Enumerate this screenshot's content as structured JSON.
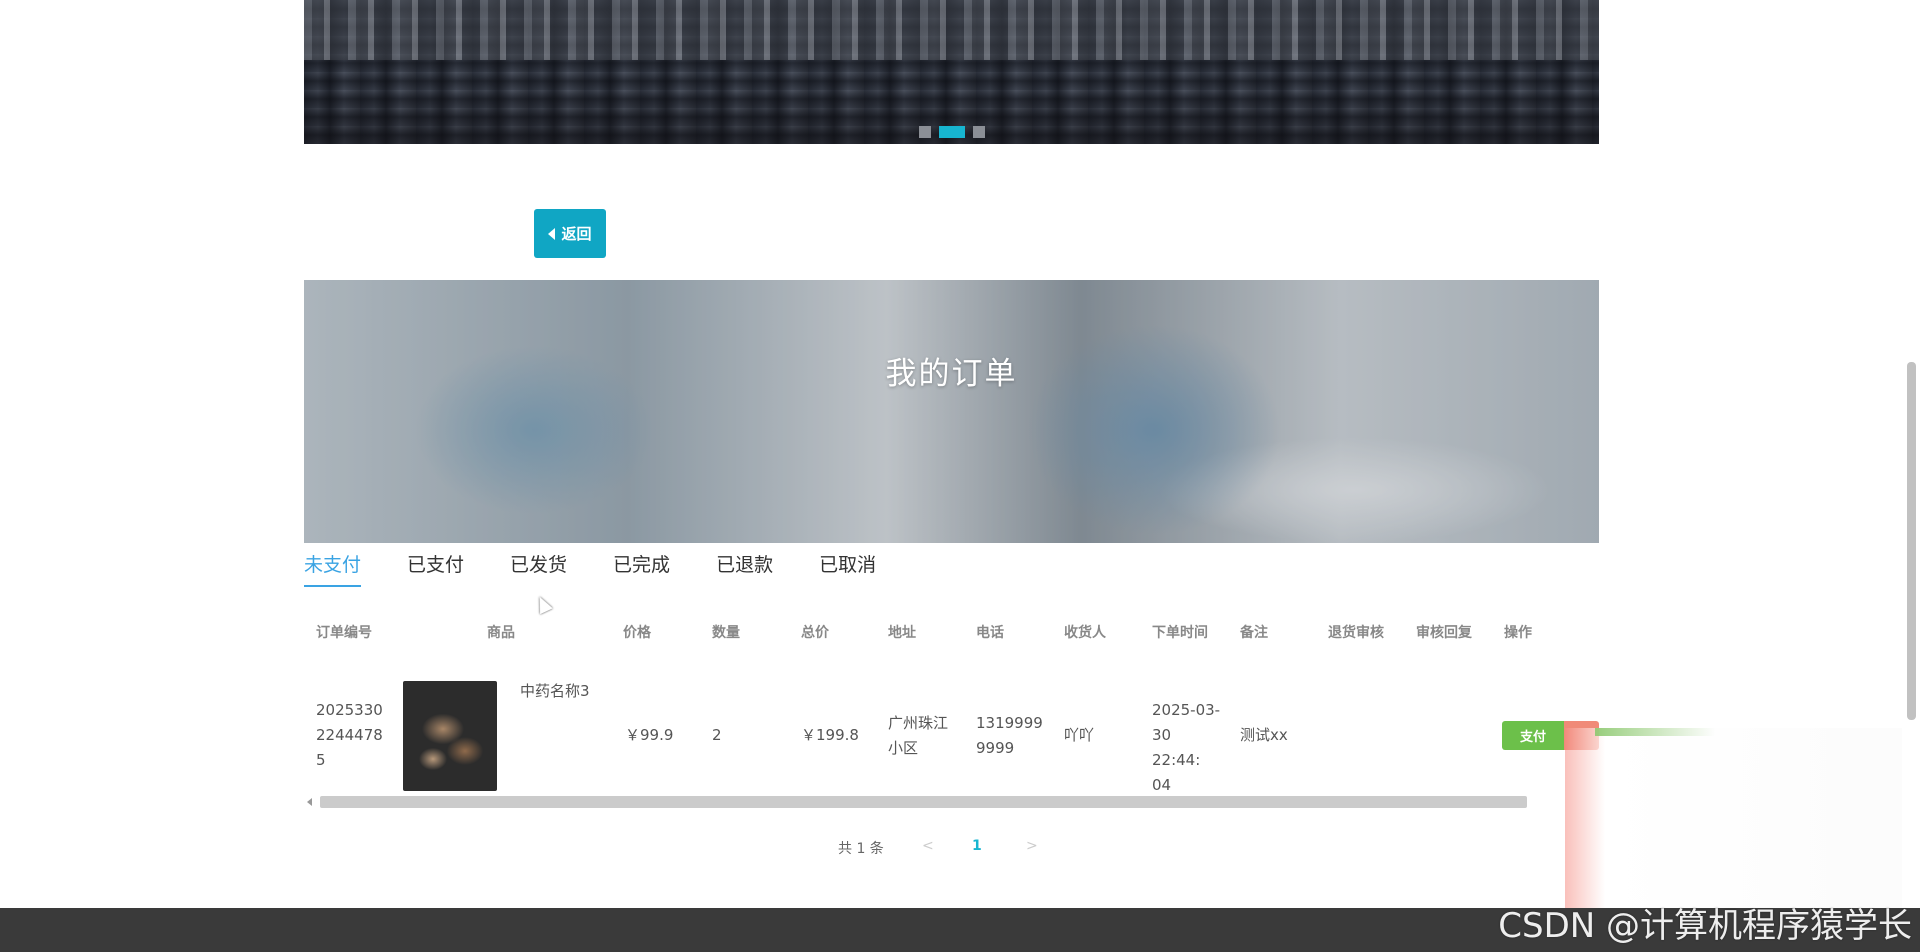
{
  "carousel": {
    "slide_count": 3,
    "active_slide": 2,
    "accent": "#17b5d0"
  },
  "back_button": {
    "label": "返回",
    "color": "#10a6c4"
  },
  "banner": {
    "title": "我的订单"
  },
  "tabs": [
    {
      "label": "未支付",
      "active": true
    },
    {
      "label": "已支付",
      "active": false
    },
    {
      "label": "已发货",
      "active": false
    },
    {
      "label": "已完成",
      "active": false
    },
    {
      "label": "已退款",
      "active": false
    },
    {
      "label": "已取消",
      "active": false
    }
  ],
  "table": {
    "headers": {
      "order_no": "订单编号",
      "product": "商品",
      "price": "价格",
      "qty": "数量",
      "total": "总价",
      "address": "地址",
      "phone": "电话",
      "receiver": "收货人",
      "order_time": "下单时间",
      "remark": "备注",
      "refund_review": "退货审核",
      "review_reply": "审核回复",
      "actions": "操作"
    },
    "rows": [
      {
        "order_no": "2025330 2244478 5",
        "product_name": "中药名称3",
        "price": "￥99.9",
        "qty": "2",
        "total": "￥199.8",
        "address": "广州珠江 小区",
        "phone": "1319999 9999",
        "receiver": "吖吖",
        "order_time": "2025-03- 30 22:44: 04",
        "remark": "测试xx",
        "refund_review": "",
        "review_reply": "",
        "pay_label": "支付"
      }
    ]
  },
  "pagination": {
    "total": "共 1 条",
    "prev": "<",
    "current": "1",
    "next": ">"
  },
  "watermark": "CSDN @计算机程序猿学长",
  "colors": {
    "pay": "#6cc04a",
    "active_tab": "#3aa3e3",
    "footer": "#3a3a3a"
  }
}
